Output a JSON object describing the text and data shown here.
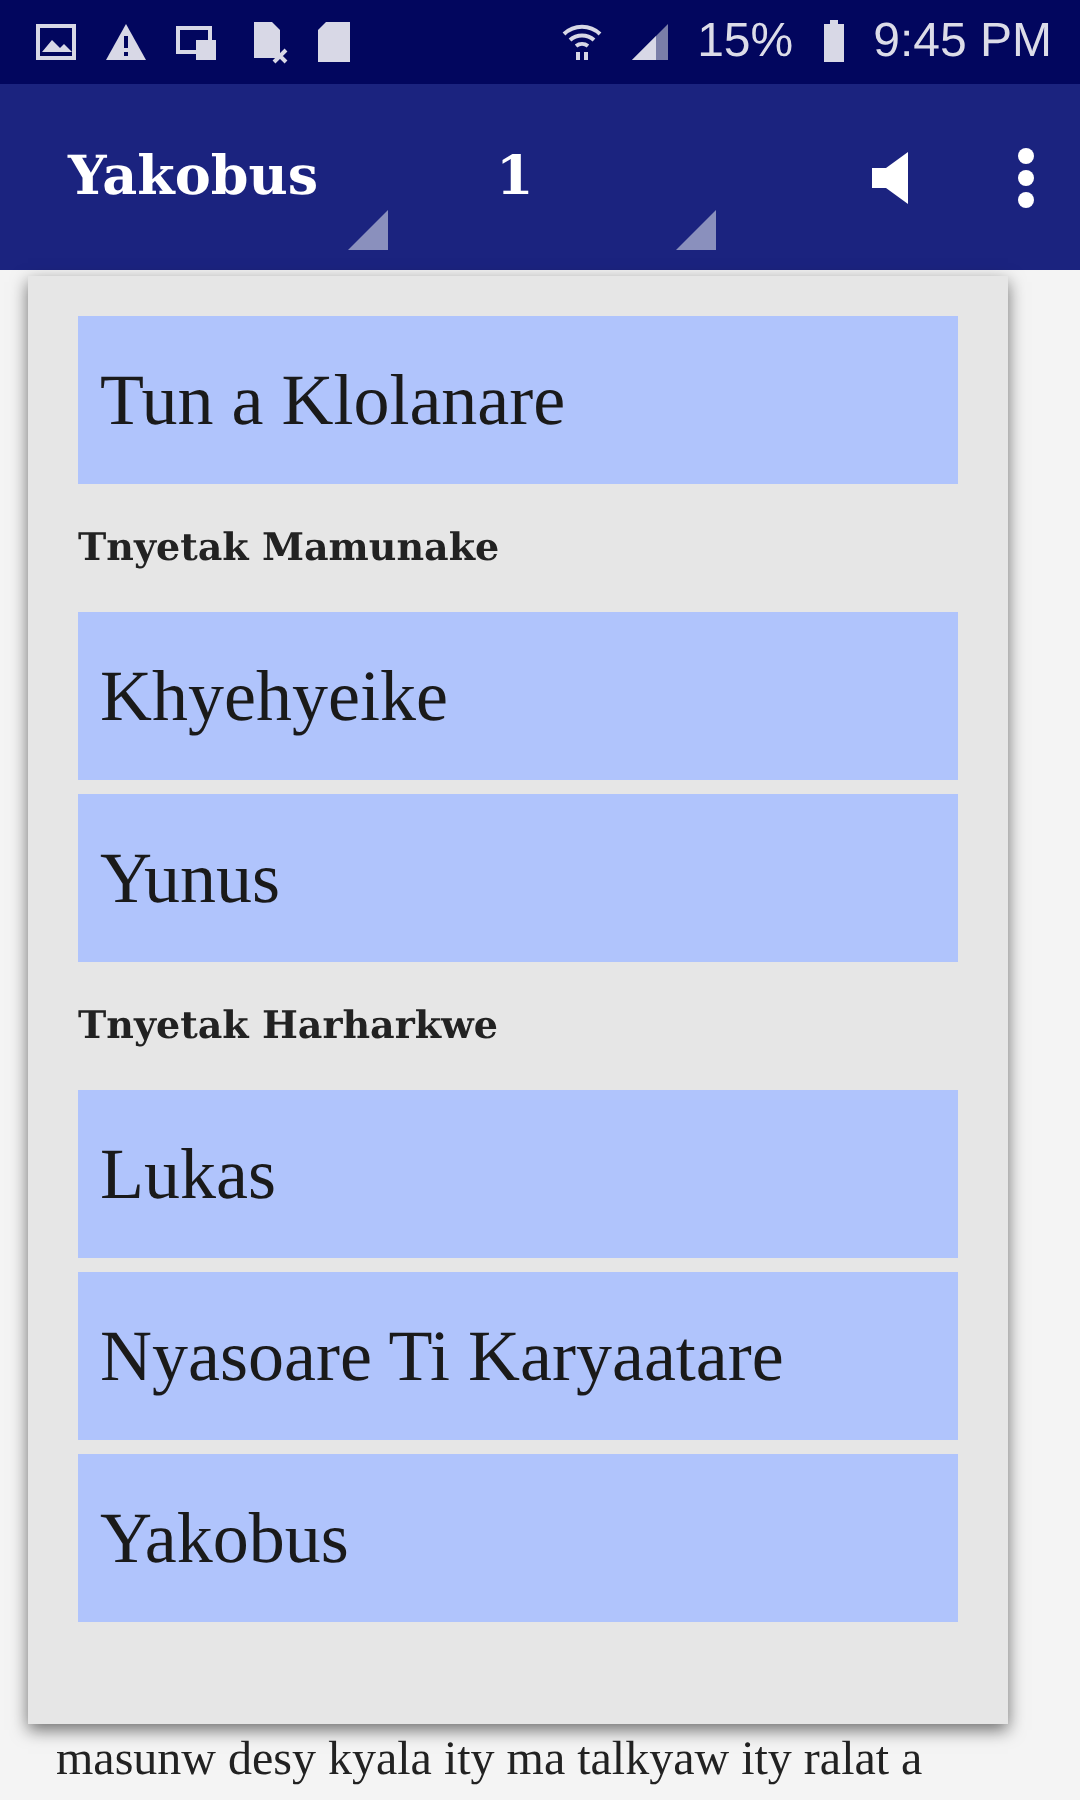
{
  "status_bar": {
    "battery": "15%",
    "time": "9:45 PM"
  },
  "toolbar": {
    "book": "Yakobus",
    "chapter": "1"
  },
  "book_menu": [
    {
      "kind": "book",
      "label": "Tun a Klolanare"
    },
    {
      "kind": "header",
      "label": "Tnyetak Mamunake"
    },
    {
      "kind": "book",
      "label": "Khyehyeike"
    },
    {
      "kind": "book",
      "label": "Yunus"
    },
    {
      "kind": "header",
      "label": "Tnyetak Harharkwe"
    },
    {
      "kind": "book",
      "label": "Lukas"
    },
    {
      "kind": "book",
      "label": "Nyasoare Ti Karyaatare"
    },
    {
      "kind": "book",
      "label": "Yakobus"
    }
  ],
  "body_text": "masunw desy kyala ity ma talkyaw ity ralat a"
}
